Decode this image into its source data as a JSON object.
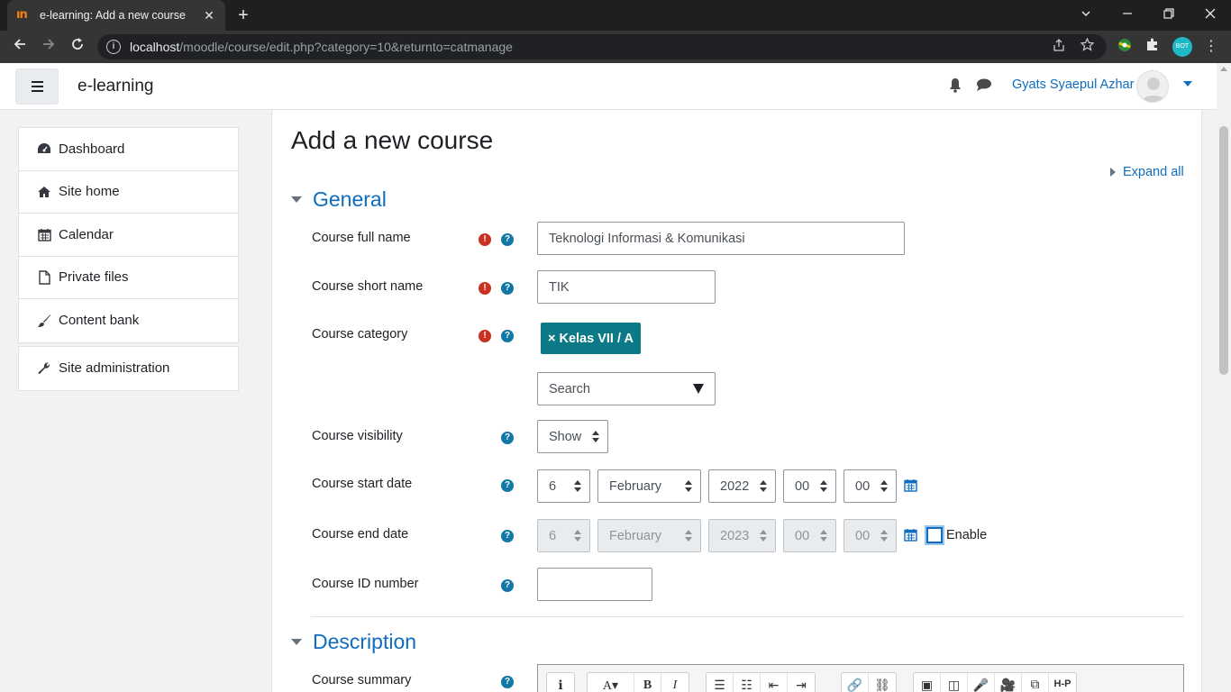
{
  "browser": {
    "tab_title": "e-learning: Add a new course",
    "tab_close": "✕",
    "new_tab": "+",
    "url_host": "localhost",
    "url_path": "/moodle/course/edit.php?category=10&returnto=catmanage",
    "window_controls": {
      "minimize": "⌄",
      "restore": "—",
      "maximize": "❐",
      "close": "✕"
    },
    "profile_initials": "BOT"
  },
  "navbar": {
    "brand": "e-learning",
    "user_name": "Gyats Syaepul Azhar"
  },
  "drawer": {
    "items": [
      {
        "label": "Dashboard",
        "icon": "dashboard-icon"
      },
      {
        "label": "Site home",
        "icon": "home-icon"
      },
      {
        "label": "Calendar",
        "icon": "calendar-icon"
      },
      {
        "label": "Private files",
        "icon": "file-icon"
      },
      {
        "label": "Content bank",
        "icon": "brush-icon"
      }
    ],
    "admin_item": {
      "label": "Site administration",
      "icon": "wrench-icon"
    }
  },
  "page": {
    "title": "Add a new course",
    "expand_all": "Expand all"
  },
  "general": {
    "title": "General",
    "full_name_label": "Course full name",
    "full_name_value": "Teknologi Informasi & Komunikasi",
    "short_name_label": "Course short name",
    "short_name_value": "TIK",
    "category_label": "Course category",
    "category_tag": "× Kelas VII / A",
    "category_search_placeholder": "Search",
    "visibility_label": "Course visibility",
    "visibility_value": "Show",
    "start_date_label": "Course start date",
    "start_date": {
      "day": "6",
      "month": "February",
      "year": "2022",
      "hour": "00",
      "minute": "00"
    },
    "end_date_label": "Course end date",
    "end_date": {
      "day": "6",
      "month": "February",
      "year": "2023",
      "hour": "00",
      "minute": "00"
    },
    "end_date_enable_label": "Enable",
    "end_date_enabled": false,
    "id_number_label": "Course ID number",
    "id_number_value": ""
  },
  "description": {
    "title": "Description",
    "summary_label": "Course summary",
    "editor_buttons": [
      "ℹ",
      "A▾",
      "B",
      "I",
      "☰",
      "☷",
      "⇤",
      "⇥",
      "🔗",
      "⛓",
      "▣",
      "◫",
      "🎤",
      "🎥",
      "⧉",
      "H-P"
    ]
  },
  "colors": {
    "link": "#0f6cbf",
    "required": "#ca3120",
    "tag": "#0b7a86",
    "help": "#1177a5"
  }
}
